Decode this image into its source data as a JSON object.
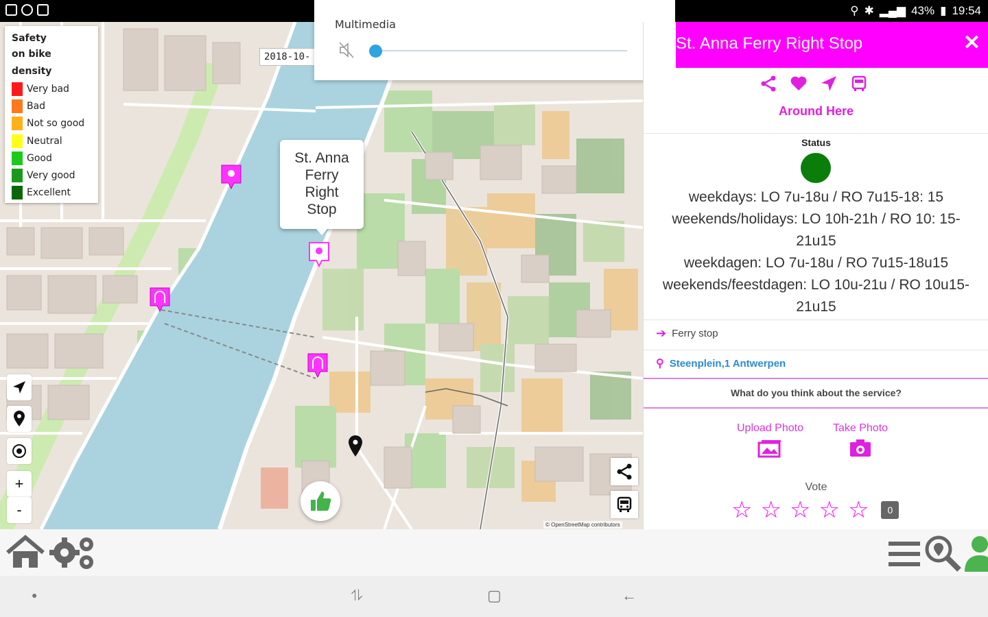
{
  "status_bar": {
    "battery": "43%",
    "time": "19:54"
  },
  "legend": {
    "title_lines": [
      "Safety",
      "on bike",
      "density"
    ],
    "items": [
      {
        "label": "Very bad",
        "color": "#ff1a1a"
      },
      {
        "label": "Bad",
        "color": "#ff7a1a"
      },
      {
        "label": "Not so good",
        "color": "#ffb01a"
      },
      {
        "label": "Neutral",
        "color": "#ffff1a"
      },
      {
        "label": "Good",
        "color": "#1acc1a"
      },
      {
        "label": "Very good",
        "color": "#1a9a1a"
      },
      {
        "label": "Excellent",
        "color": "#0a660a"
      }
    ]
  },
  "map": {
    "date_chip": "2018-10-",
    "popup_lines": [
      "St. Anna",
      "Ferry",
      "Right",
      "Stop"
    ],
    "attribution": "© OpenStreetMap contributors"
  },
  "media": {
    "title": "Multimedia",
    "volume": 0
  },
  "panel": {
    "title": "St. Anna Ferry Right Stop",
    "around_here": "Around Here",
    "status_label": "Status",
    "status_color": "#0a7d0a",
    "hours": [
      "weekdays: LO 7u-18u / RO 7u15-18: 15",
      "weekends/holidays: LO 10h-21h / RO 10: 15-",
      "21u15",
      "weekdagen: LO 7u-18u / RO 7u15-18u15",
      "weekends/feestdagen: LO 10u-21u / RO 10u15-",
      "21u15"
    ],
    "category": "Ferry stop",
    "address": "Steenplein,1 Antwerpen",
    "question": "What do you think about the service?",
    "upload_photo": "Upload Photo",
    "take_photo": "Take Photo",
    "vote_label": "Vote",
    "rating": 0,
    "vote_count": "0"
  },
  "colors": {
    "accent": "#ff00ff",
    "link": "#2a8ccf"
  }
}
